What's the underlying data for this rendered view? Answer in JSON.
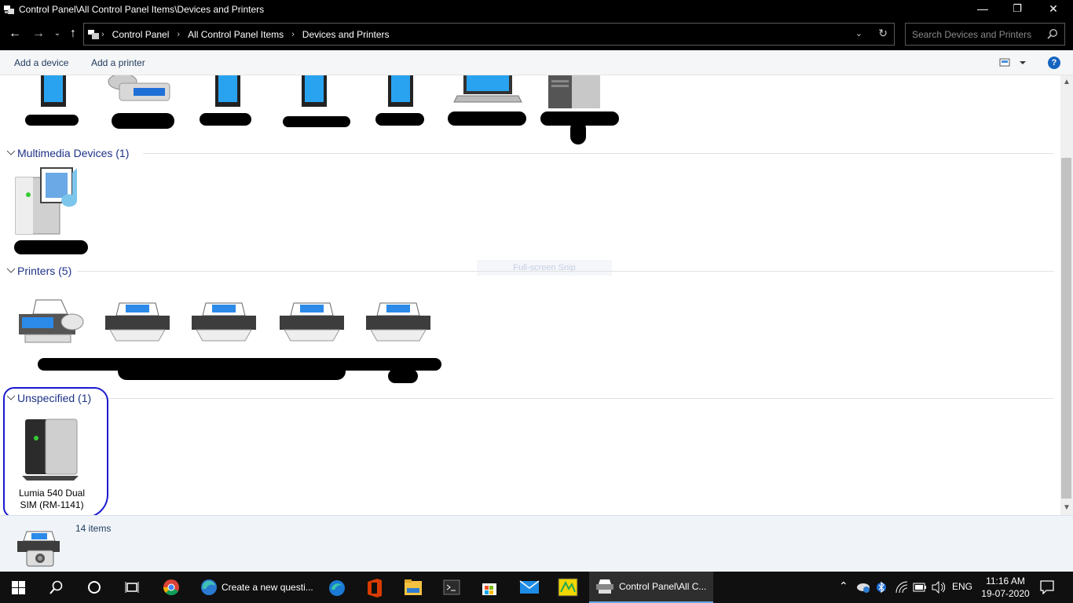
{
  "window": {
    "title": "Control Panel\\All Control Panel Items\\Devices and Printers",
    "minimize": "—",
    "maximize": "❐",
    "close": "✕"
  },
  "address": {
    "crumbs": [
      "Control Panel",
      "All Control Panel Items",
      "Devices and Printers"
    ],
    "separator": "›"
  },
  "search": {
    "placeholder": "Search Devices and Printers"
  },
  "commands": {
    "add_device": "Add a device",
    "add_printer": "Add a printer",
    "help": "?"
  },
  "groups": {
    "multimedia": "Multimedia Devices (1)",
    "printers": "Printers (5)",
    "unspecified": "Unspecified (1)"
  },
  "unspecified_device": {
    "label_line1": "Lumia 540 Dual",
    "label_line2": "SIM (RM-1141)"
  },
  "snip_hint": "Full-screen Snip",
  "details": {
    "count": "14 items"
  },
  "taskbar": {
    "edge_task_label": "Create a new questi...",
    "control_panel_task_label": "Control Panel\\All C...",
    "language": "ENG",
    "time": "11:16 AM",
    "date": "19-07-2020"
  },
  "colors": {
    "accent": "#1565c0",
    "group_header": "#1e3287",
    "selection_ring": "#1a1ad0"
  }
}
